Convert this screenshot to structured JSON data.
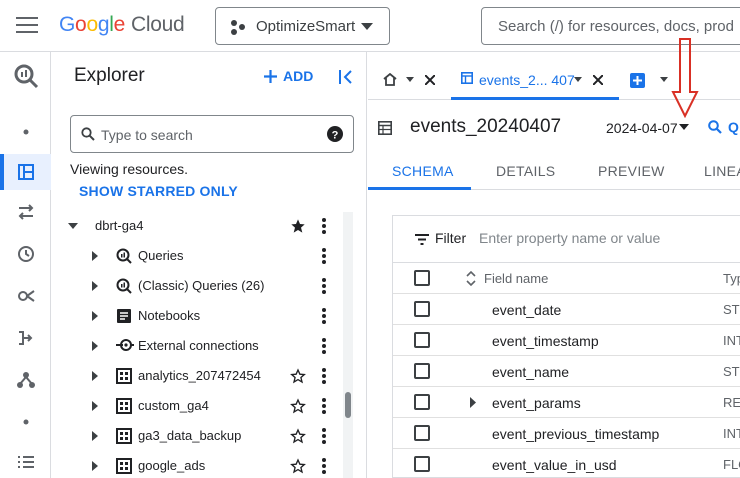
{
  "header": {
    "logo_google": "Google",
    "logo_cloud": "Cloud",
    "project": "OptimizeSmart",
    "search_placeholder": "Search (/) for resources, docs, prod"
  },
  "colors": {
    "accent": "#1a73e8",
    "annotation": "#d93025"
  },
  "rail": {
    "items": [
      {
        "icon": "bigquery-logo-icon"
      },
      {
        "icon": "dot-icon"
      },
      {
        "icon": "workspace-icon",
        "active": true
      },
      {
        "icon": "transfers-icon"
      },
      {
        "icon": "history-icon"
      },
      {
        "icon": "analytics-hub-icon"
      },
      {
        "icon": "dataform-icon"
      },
      {
        "icon": "partner-center-icon"
      },
      {
        "icon": "dot-icon"
      },
      {
        "icon": "list-icon"
      }
    ]
  },
  "explorer": {
    "title": "Explorer",
    "add_label": "ADD",
    "search_placeholder": "Type to search",
    "viewing": "Viewing resources.",
    "starred_label": "SHOW STARRED ONLY",
    "project_node": {
      "label": "dbrt-ga4",
      "starred": true
    },
    "children": [
      {
        "label": "Queries",
        "icon": "queries-icon",
        "starrable": false
      },
      {
        "label": "(Classic) Queries (26)",
        "icon": "queries-icon",
        "starrable": false
      },
      {
        "label": "Notebooks",
        "icon": "notebook-icon",
        "starrable": false
      },
      {
        "label": "External connections",
        "icon": "connection-icon",
        "starrable": false
      },
      {
        "label": "analytics_207472454",
        "icon": "dataset-icon",
        "starrable": true
      },
      {
        "label": "custom_ga4",
        "icon": "dataset-icon",
        "starrable": true
      },
      {
        "label": "ga3_data_backup",
        "icon": "dataset-icon",
        "starrable": true
      },
      {
        "label": "google_ads",
        "icon": "dataset-icon",
        "starrable": true
      }
    ]
  },
  "main": {
    "tab_active_label": "events_2... 407",
    "table_title": "events_20240407",
    "date_value": "2024-04-07",
    "query_label": "Q",
    "subtabs": [
      "SCHEMA",
      "DETAILS",
      "PREVIEW",
      "LINEA"
    ],
    "filter_label": "Filter",
    "filter_placeholder": "Enter property name or value",
    "schema_header": {
      "name": "Field name",
      "type": "Typ"
    },
    "schema_rows": [
      {
        "name": "event_date",
        "type": "STI",
        "expandable": false
      },
      {
        "name": "event_timestamp",
        "type": "INT",
        "expandable": false
      },
      {
        "name": "event_name",
        "type": "STI",
        "expandable": false
      },
      {
        "name": "event_params",
        "type": "REC",
        "expandable": true
      },
      {
        "name": "event_previous_timestamp",
        "type": "INT",
        "expandable": false
      },
      {
        "name": "event_value_in_usd",
        "type": "FLC",
        "expandable": false
      }
    ]
  }
}
